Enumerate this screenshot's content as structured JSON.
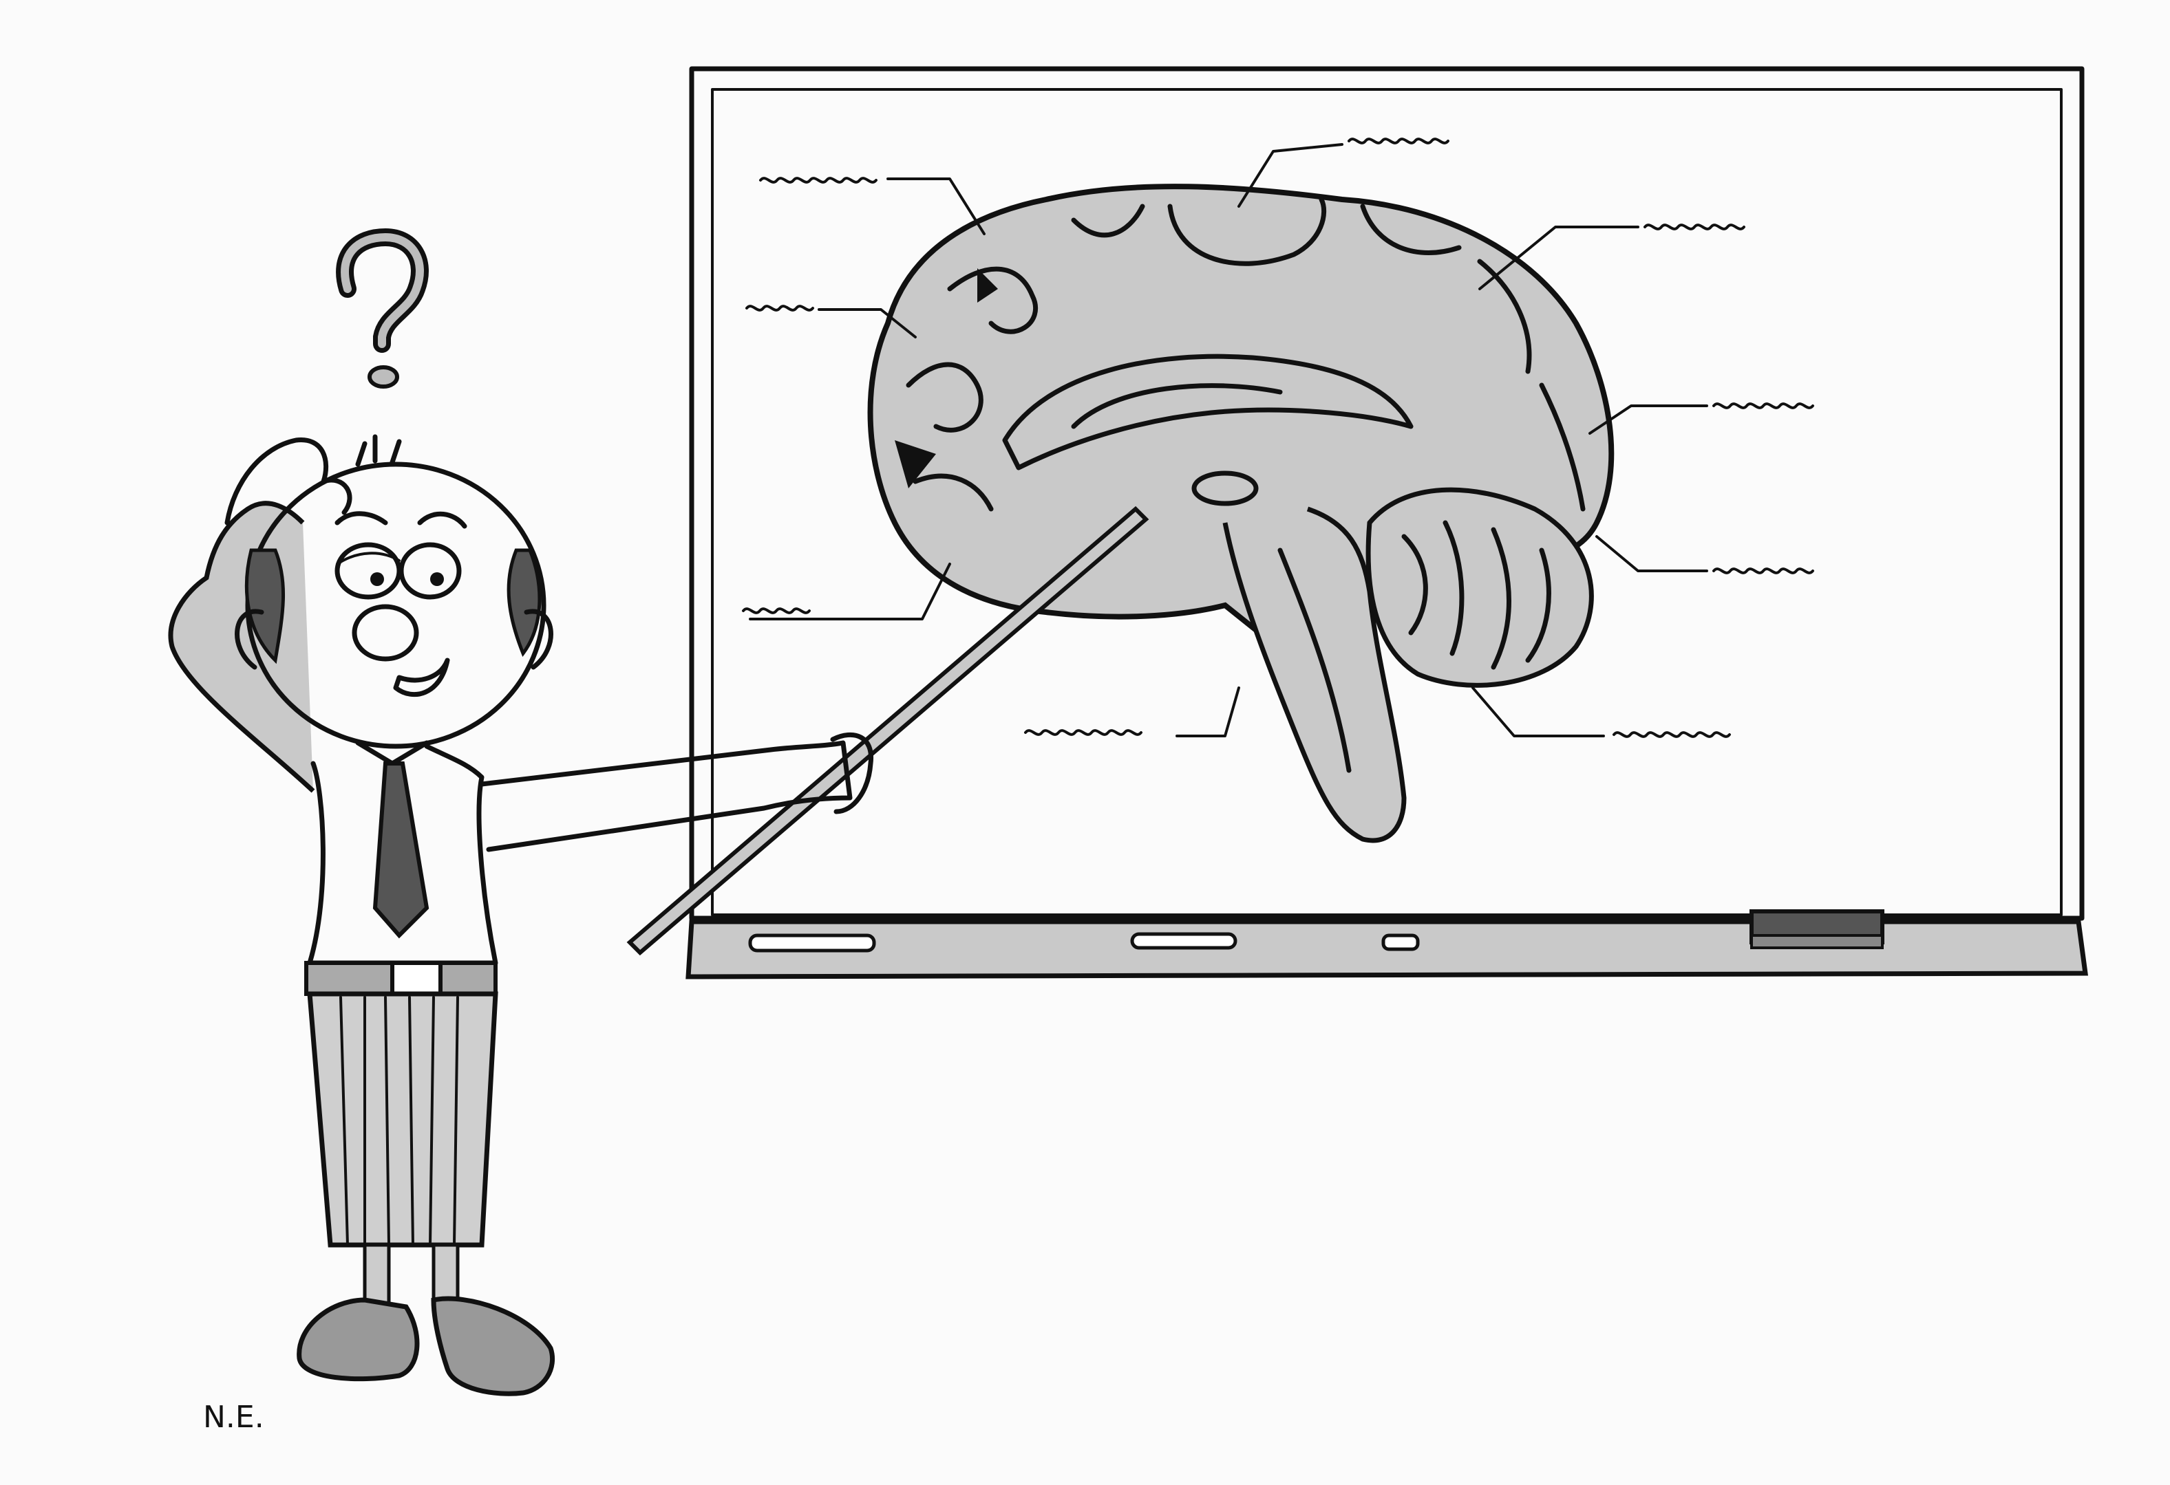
{
  "signature": "N.E.",
  "question_mark": "?",
  "board_labels": [
    {
      "id": "label-top-left",
      "text": ""
    },
    {
      "id": "label-top",
      "text": ""
    },
    {
      "id": "label-top-right",
      "text": ""
    },
    {
      "id": "label-left",
      "text": ""
    },
    {
      "id": "label-right",
      "text": ""
    },
    {
      "id": "label-bottom-left",
      "text": ""
    },
    {
      "id": "label-right-lower",
      "text": ""
    },
    {
      "id": "label-bottom",
      "text": ""
    },
    {
      "id": "label-bottom-right",
      "text": ""
    }
  ],
  "icons": {
    "question": "question-mark-icon",
    "brain": "brain-diagram-icon",
    "eraser": "eraser-icon",
    "pointer": "pointer-stick-icon"
  }
}
